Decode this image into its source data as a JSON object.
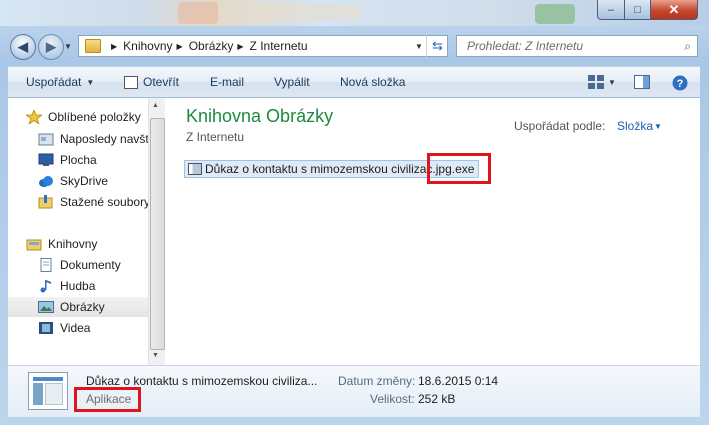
{
  "window": {
    "minimize_symbol": "–",
    "maximize_symbol": "□",
    "close_symbol": "✕"
  },
  "address_bar": {
    "breadcrumbs": [
      "Knihovny",
      "Obrázky",
      "Z Internetu"
    ]
  },
  "search": {
    "placeholder": "Prohledat: Z Internetu"
  },
  "toolbar": {
    "organize_label": "Uspořádat",
    "open_label": "Otevřít",
    "email_label": "E-mail",
    "burn_label": "Vypálit",
    "new_folder_label": "Nová složka"
  },
  "sidebar": {
    "favorites_label": "Oblíbené položky",
    "favorites": [
      "Naposledy navšti",
      "Plocha",
      "SkyDrive",
      "Stažené soubory"
    ],
    "libraries_label": "Knihovny",
    "libraries": [
      "Dokumenty",
      "Hudba",
      "Obrázky",
      "Videa"
    ]
  },
  "main": {
    "title": "Knihovna Obrázky",
    "subtitle": "Z Internetu",
    "arrange_label": "Uspořádat podle:",
    "arrange_value": "Složka",
    "file_name_start": "Důkaz o kontaktu s mimozemskou civilizac",
    "file_name_ext": ".jpg.exe"
  },
  "details": {
    "name": "Důkaz o kontaktu s mimozemskou civiliza...",
    "type": "Aplikace",
    "date_label": "Datum změny:",
    "date_value": "18.6.2015 0:14",
    "size_label": "Velikost:",
    "size_value": "252 kB"
  },
  "colors": {
    "title_green": "#1e8a3c",
    "link_blue": "#1a5fb4",
    "highlight_red": "#e0141e"
  }
}
